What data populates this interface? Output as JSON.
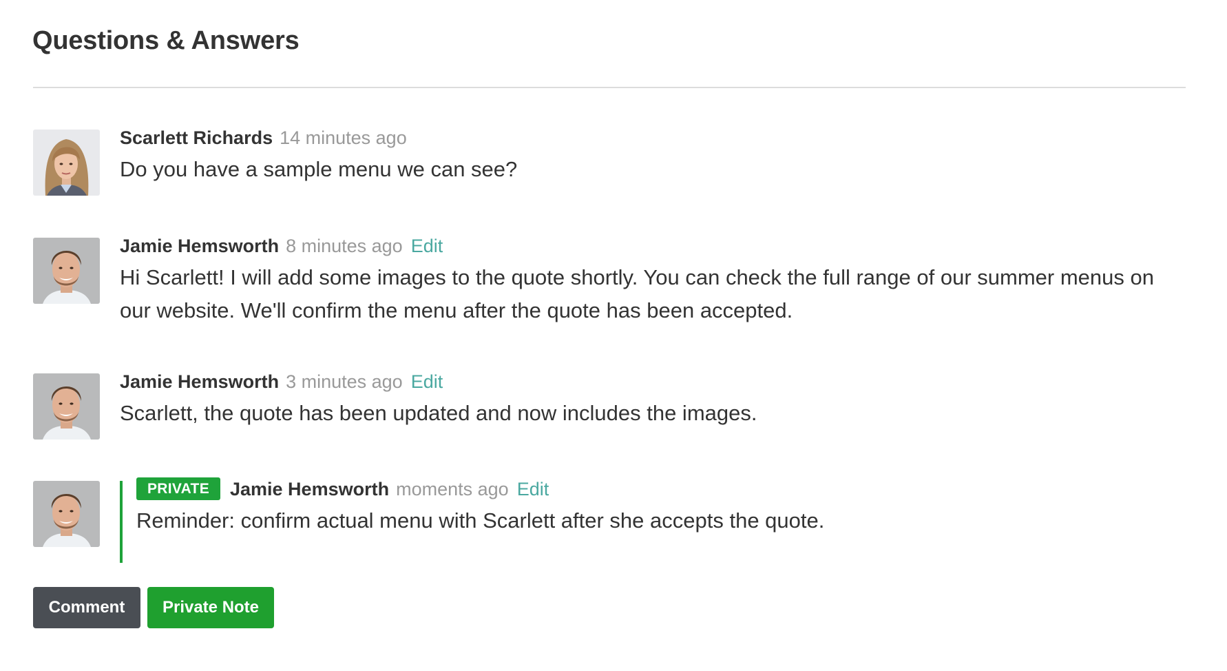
{
  "page": {
    "title": "Questions & Answers"
  },
  "colors": {
    "text": "#333333",
    "muted": "#999999",
    "link": "#4aa8a0",
    "private_green": "#1fa33a",
    "comment_button": "#4a4e54",
    "private_button": "#1fa02f",
    "divider": "#dcdcdc"
  },
  "comments": [
    {
      "author": "Scarlett Richards",
      "time": "14 minutes ago",
      "text": "Do you have a sample menu we can see?",
      "avatar": "female-avatar",
      "editable": false,
      "private": false
    },
    {
      "author": "Jamie Hemsworth",
      "time": "8 minutes ago",
      "edit_label": "Edit",
      "text": "Hi Scarlett! I will add some images to the quote shortly. You can check the full range of our summer menus on our website. We'll confirm the menu after the quote has been accepted.",
      "avatar": "male-avatar",
      "editable": true,
      "private": false
    },
    {
      "author": "Jamie Hemsworth",
      "time": "3 minutes ago",
      "edit_label": "Edit",
      "text": "Scarlett, the quote has been updated and now includes the images.",
      "avatar": "male-avatar",
      "editable": true,
      "private": false
    },
    {
      "badge": "PRIVATE",
      "author": "Jamie Hemsworth",
      "time": "moments ago",
      "edit_label": "Edit",
      "text": "Reminder: confirm actual menu with Scarlett after she accepts the quote.",
      "avatar": "male-avatar",
      "editable": true,
      "private": true
    }
  ],
  "actions": {
    "comment_label": "Comment",
    "private_note_label": "Private Note"
  }
}
